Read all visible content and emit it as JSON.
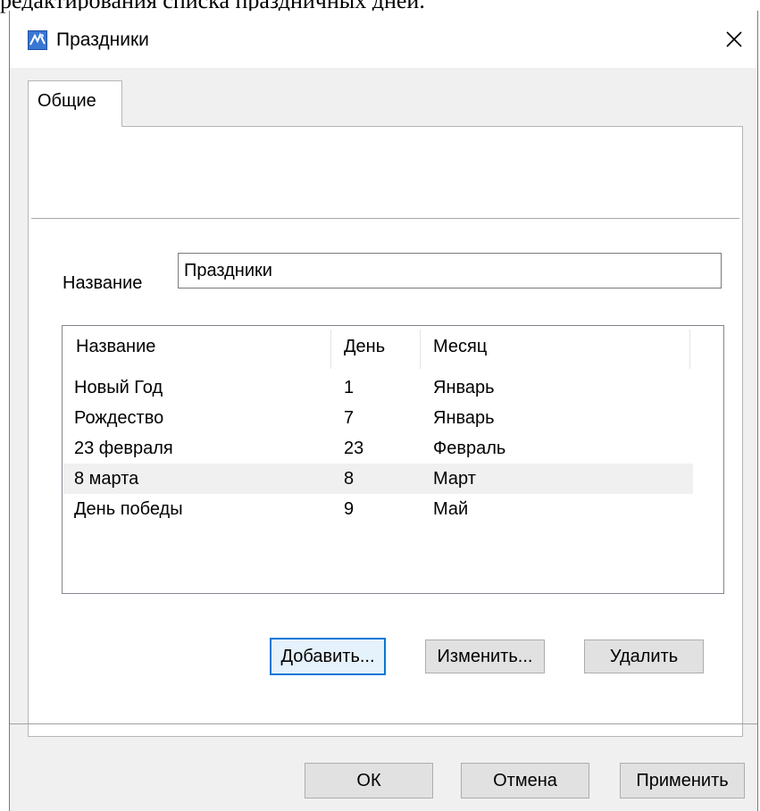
{
  "background_text": "редактирования списка праздничных дней.",
  "window": {
    "title": "Праздники",
    "app_icon": "app-calendar-icon",
    "close_glyph": "✕"
  },
  "tabs": [
    {
      "label": "Общие",
      "selected": true
    }
  ],
  "form": {
    "name_label": "Название",
    "name_value": "Праздники"
  },
  "table": {
    "columns": [
      "Название",
      "День",
      "Месяц"
    ],
    "rows": [
      {
        "name": "Новый Год",
        "day": "1",
        "month": "Январь"
      },
      {
        "name": "Рождество",
        "day": "7",
        "month": "Январь"
      },
      {
        "name": "23 февраля",
        "day": "23",
        "month": "Февраль"
      },
      {
        "name": "8 марта",
        "day": "8",
        "month": "Март"
      },
      {
        "name": "День победы",
        "day": "9",
        "month": "Май"
      }
    ],
    "selected_row_index": 3
  },
  "list_buttons": {
    "add": "Добавить...",
    "edit": "Изменить...",
    "delete": "Удалить"
  },
  "dialog_buttons": {
    "ok": "ОК",
    "cancel": "Отмена",
    "apply": "Применить"
  },
  "colors": {
    "focus_border": "#0078d7",
    "selected_row": "#f0f0f0",
    "dialog_bg": "#f0f0f0"
  }
}
